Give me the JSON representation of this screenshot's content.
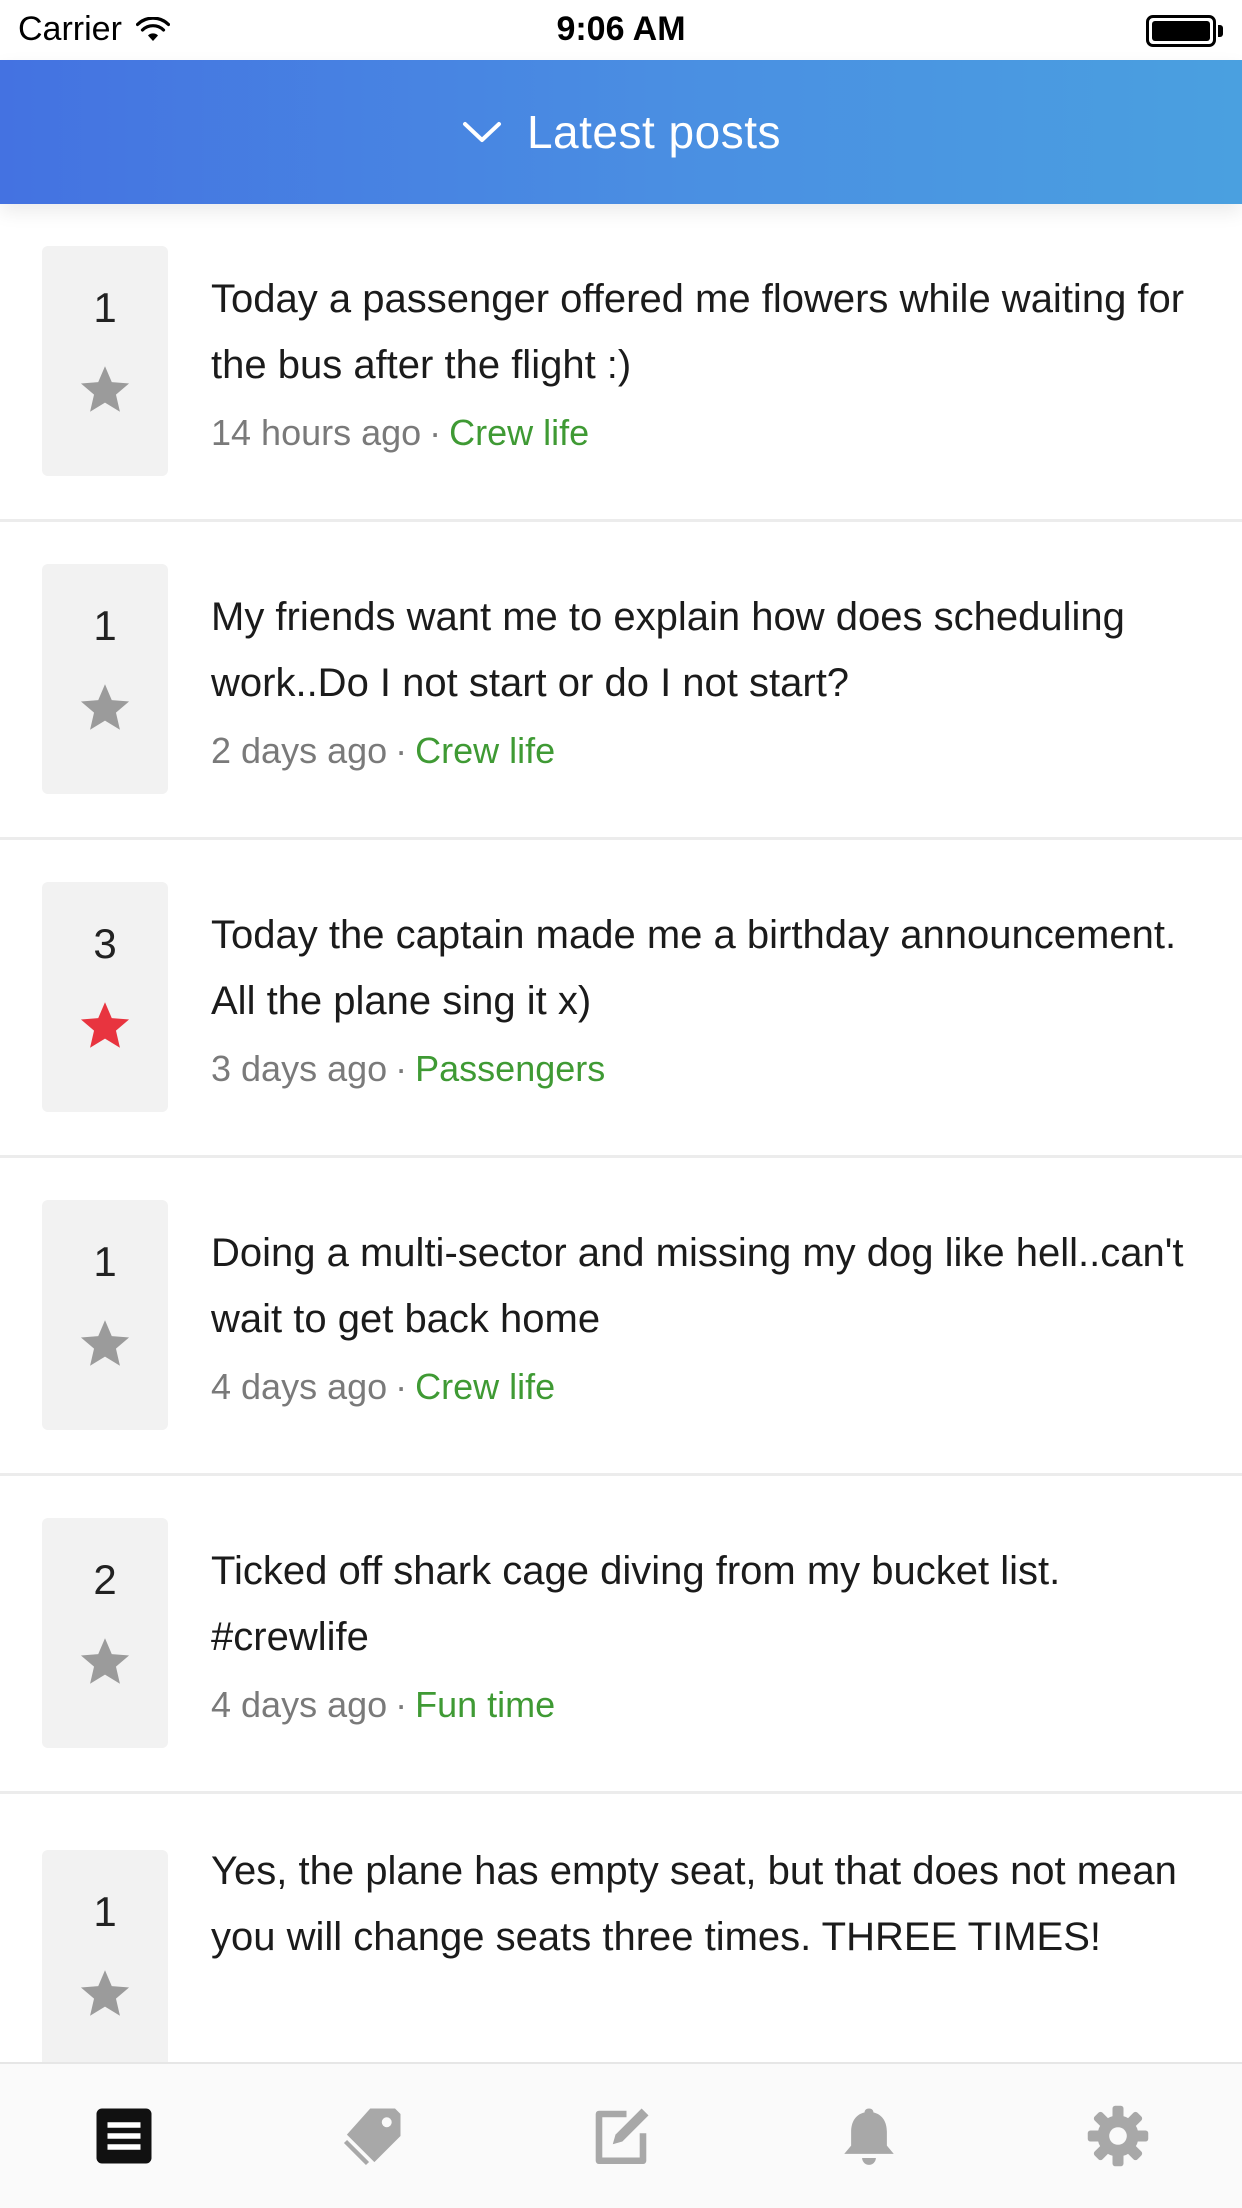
{
  "status_bar": {
    "carrier": "Carrier",
    "time": "9:06 AM"
  },
  "header": {
    "title": "Latest posts"
  },
  "posts": [
    {
      "votes": "1",
      "starred": false,
      "text": "Today a passenger offered me flowers while waiting for the bus after the flight :)",
      "time": "14 hours ago",
      "separator": "·",
      "category": "Crew life"
    },
    {
      "votes": "1",
      "starred": false,
      "text": "My friends want me to explain how does scheduling work..Do I not start or do I not start?",
      "time": "2 days ago",
      "separator": "·",
      "category": "Crew life"
    },
    {
      "votes": "3",
      "starred": true,
      "text": "Today the captain made me a birthday announcement. All the plane sing it x)",
      "time": "3 days ago",
      "separator": "·",
      "category": "Passengers"
    },
    {
      "votes": "1",
      "starred": false,
      "text": "Doing a multi-sector and missing my dog like hell..can't wait to get back home",
      "time": "4 days ago",
      "separator": "·",
      "category": "Crew life"
    },
    {
      "votes": "2",
      "starred": false,
      "text": "Ticked off shark cage diving from my bucket list. #crewlife",
      "time": "4 days ago",
      "separator": "·",
      "category": "Fun time"
    },
    {
      "votes": "1",
      "starred": false,
      "text": "Yes, the plane has empty seat, but that does not mean you will change seats three times. THREE TIMES!",
      "time": "",
      "separator": "",
      "category": ""
    }
  ],
  "tabs": [
    {
      "icon": "posts-list-icon",
      "active": true
    },
    {
      "icon": "tag-icon",
      "active": false
    },
    {
      "icon": "compose-icon",
      "active": false
    },
    {
      "icon": "bell-icon",
      "active": false
    },
    {
      "icon": "gear-icon",
      "active": false
    }
  ],
  "colors": {
    "header_start": "#4472e1",
    "header_end": "#4aa0e0",
    "category": "#3f9a34",
    "star_active": "#e8343f",
    "star_inactive": "#9b9b9b",
    "tab_active": "#111111",
    "tab_inactive": "#a8a8a8"
  }
}
